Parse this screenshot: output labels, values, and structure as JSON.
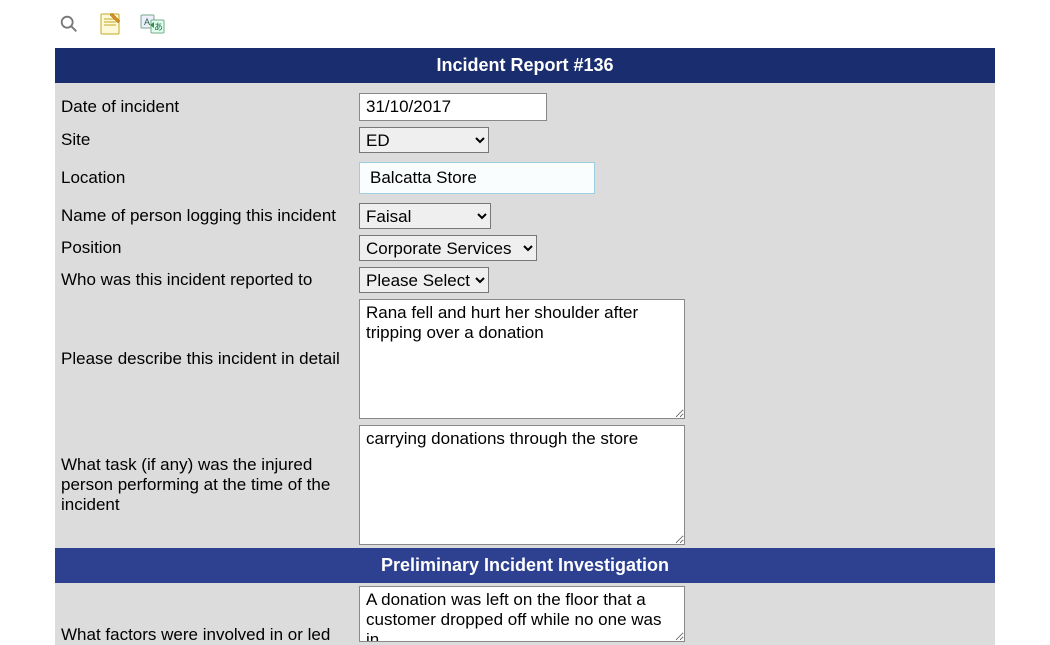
{
  "header": {
    "title": "Incident Report #136"
  },
  "subheader": {
    "title": "Preliminary Incident Investigation"
  },
  "form": {
    "date_label": "Date of incident",
    "date_value": "31/10/2017",
    "site_label": "Site",
    "site_value": "ED",
    "location_label": "Location",
    "location_value": "Balcatta Store",
    "person_label": "Name of person logging this incident",
    "person_value": "Faisal",
    "position_label": "Position",
    "position_value": "Corporate Services",
    "reported_label": "Who was this incident reported to",
    "reported_value": "Please Select",
    "describe_label": "Please describe this incident in detail",
    "describe_value": "Rana fell and hurt her shoulder after tripping over a donation",
    "task_label": "What task (if any) was the injured person performing at the time of the incident",
    "task_value": "carrying donations through the store",
    "factors_label": "What factors were involved in or led",
    "factors_value": "A donation was left on the floor that a customer dropped off while no one was in"
  }
}
